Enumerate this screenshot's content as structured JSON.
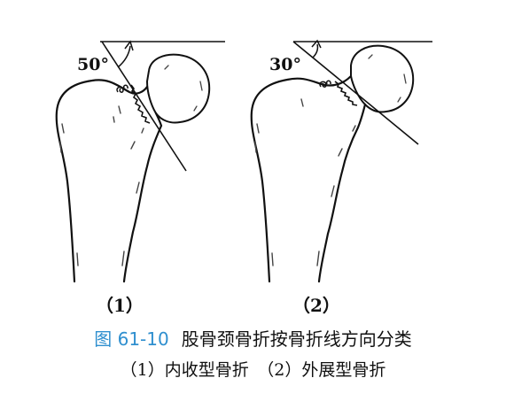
{
  "figure": {
    "number": "图 61-10",
    "title": "股骨颈骨折按骨折线方向分类",
    "subcaption": "（1）内收型骨折　（2）外展型骨折",
    "panels": [
      {
        "id": "1",
        "label": "（1）",
        "angle_label": "50°",
        "angle_deg": 50
      },
      {
        "id": "2",
        "label": "（2）",
        "angle_label": "30°",
        "angle_deg": 30
      }
    ]
  },
  "colors": {
    "ink": "#111111",
    "figure_number": "#2f8fcf",
    "background": "#ffffff"
  }
}
